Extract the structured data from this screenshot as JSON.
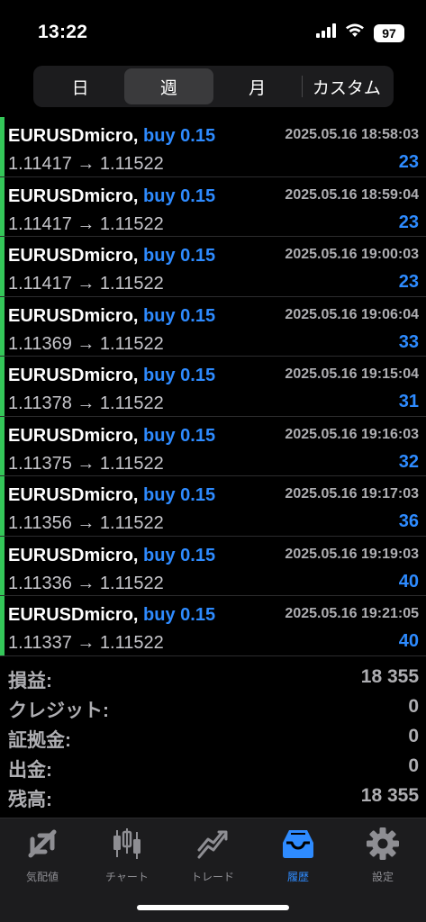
{
  "status": {
    "time": "13:22",
    "battery": "97"
  },
  "segments": [
    {
      "label": "日"
    },
    {
      "label": "週"
    },
    {
      "label": "月"
    },
    {
      "label": "カスタム"
    }
  ],
  "trades": [
    {
      "symbol": "EURUSDmicro,",
      "side": "buy 0.15",
      "prices": "1.11417 → 1.11522",
      "time": "2025.05.16 18:58:03",
      "profit": "23"
    },
    {
      "symbol": "EURUSDmicro,",
      "side": "buy 0.15",
      "prices": "1.11417 → 1.11522",
      "time": "2025.05.16 18:59:04",
      "profit": "23"
    },
    {
      "symbol": "EURUSDmicro,",
      "side": "buy 0.15",
      "prices": "1.11417 → 1.11522",
      "time": "2025.05.16 19:00:03",
      "profit": "23"
    },
    {
      "symbol": "EURUSDmicro,",
      "side": "buy 0.15",
      "prices": "1.11369 → 1.11522",
      "time": "2025.05.16 19:06:04",
      "profit": "33"
    },
    {
      "symbol": "EURUSDmicro,",
      "side": "buy 0.15",
      "prices": "1.11378 → 1.11522",
      "time": "2025.05.16 19:15:04",
      "profit": "31"
    },
    {
      "symbol": "EURUSDmicro,",
      "side": "buy 0.15",
      "prices": "1.11375 → 1.11522",
      "time": "2025.05.16 19:16:03",
      "profit": "32"
    },
    {
      "symbol": "EURUSDmicro,",
      "side": "buy 0.15",
      "prices": "1.11356 → 1.11522",
      "time": "2025.05.16 19:17:03",
      "profit": "36"
    },
    {
      "symbol": "EURUSDmicro,",
      "side": "buy 0.15",
      "prices": "1.11336 → 1.11522",
      "time": "2025.05.16 19:19:03",
      "profit": "40"
    },
    {
      "symbol": "EURUSDmicro,",
      "side": "buy 0.15",
      "prices": "1.11337 → 1.11522",
      "time": "2025.05.16 19:21:05",
      "profit": "40"
    }
  ],
  "summary": [
    {
      "label": "損益:",
      "value": "18 355"
    },
    {
      "label": "クレジット:",
      "value": "0"
    },
    {
      "label": "証拠金:",
      "value": "0"
    },
    {
      "label": "出金:",
      "value": "0"
    },
    {
      "label": "残高:",
      "value": "18 355"
    }
  ],
  "tabs": [
    {
      "label": "気配値",
      "icon": "quotes-icon"
    },
    {
      "label": "チャート",
      "icon": "candlestick-chart-icon"
    },
    {
      "label": "トレード",
      "icon": "trade-icon"
    },
    {
      "label": "履歴",
      "icon": "history-inbox-icon"
    },
    {
      "label": "設定",
      "icon": "gear-icon"
    }
  ],
  "colors": {
    "accent_blue": "#2e8bff",
    "accent_green": "#34c759"
  }
}
